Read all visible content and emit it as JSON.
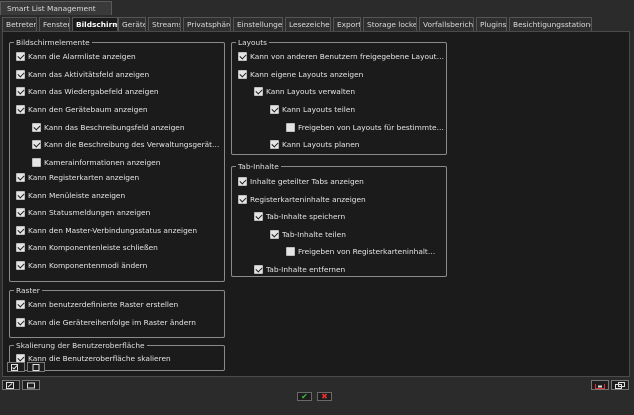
{
  "window": {
    "title": "Smart List Management"
  },
  "tabs": [
    {
      "label": "Betreten"
    },
    {
      "label": "Fenster"
    },
    {
      "label": "Bildschirm"
    },
    {
      "label": "Geräte"
    },
    {
      "label": "Streams"
    },
    {
      "label": "Privatsphäre"
    },
    {
      "label": "Einstellungen"
    },
    {
      "label": "Lesezeichen"
    },
    {
      "label": "Export"
    },
    {
      "label": "Storage locker"
    },
    {
      "label": "Vorfallsbericht"
    },
    {
      "label": "Plugins"
    },
    {
      "label": "Besichtigungsstationen"
    }
  ],
  "active_tab": "Bildschirm",
  "groups": {
    "bildschirmelemente": {
      "legend": "Bildschirmelemente",
      "items": [
        {
          "label": "Kann die Alarmliste anzeigen",
          "checked": true
        },
        {
          "label": "Kann das Aktivitätsfeld anzeigen",
          "checked": true
        },
        {
          "label": "Kann das Wiedergabefeld anzeigen",
          "checked": true
        },
        {
          "label": "Kann den Gerätebaum anzeigen",
          "checked": true
        },
        {
          "label": "Kann das Beschreibungsfeld anzeigen",
          "checked": true
        },
        {
          "label": "Kann die Beschreibung des Verwaltungsgeräts anzei...",
          "checked": true
        },
        {
          "label": "Kamerainformationen anzeigen",
          "checked": false
        },
        {
          "label": "Kann Registerkarten anzeigen",
          "checked": true
        },
        {
          "label": "Kann Menüleiste anzeigen",
          "checked": true
        },
        {
          "label": "Kann Statusmeldungen anzeigen",
          "checked": true
        },
        {
          "label": "Kann den Master-Verbindungsstatus anzeigen",
          "checked": true
        },
        {
          "label": "Kann Komponentenleiste schließen",
          "checked": true
        },
        {
          "label": "Kann Komponentenmodi ändern",
          "checked": true
        }
      ]
    },
    "raster": {
      "legend": "Raster",
      "items": [
        {
          "label": "Kann benutzerdefinierte Raster erstellen",
          "checked": true
        },
        {
          "label": "Kann die Gerätereihenfolge im Raster ändern",
          "checked": true
        }
      ]
    },
    "skalierung": {
      "legend": "Skalierung der Benutzeroberfläche",
      "items": [
        {
          "label": "Kann die Benutzeroberfläche skalieren",
          "checked": true
        }
      ]
    },
    "layouts": {
      "legend": "Layouts",
      "items": [
        {
          "label": "Kann von anderen Benutzern freigegebene Layouts anzei...",
          "checked": true
        },
        {
          "label": "Kann eigene Layouts anzeigen",
          "checked": true
        },
        {
          "label": "Kann Layouts verwalten",
          "checked": true
        },
        {
          "label": "Kann Layouts teilen",
          "checked": true
        },
        {
          "label": "Freigeben von Layouts für bestimmte Benutzer",
          "checked": false
        },
        {
          "label": "Kann Layouts planen",
          "checked": true
        }
      ]
    },
    "tabinhalte": {
      "legend": "Tab-Inhalte",
      "items": [
        {
          "label": "Inhalte geteilter Tabs anzeigen",
          "checked": true
        },
        {
          "label": "Registerkarteninhalte anzeigen",
          "checked": true
        },
        {
          "label": "Tab-Inhalte speichern",
          "checked": true
        },
        {
          "label": "Tab-Inhalte teilen",
          "checked": true
        },
        {
          "label": "Freigeben von Registerkarteninhalten fü...",
          "checked": false
        },
        {
          "label": "Tab-Inhalte entfernen",
          "checked": true
        }
      ]
    }
  },
  "footer": {
    "confirm_symbol": "✔",
    "cancel_symbol": "✖"
  },
  "colors": {
    "confirm": "#3fbf3f",
    "cancel": "#e03030"
  }
}
